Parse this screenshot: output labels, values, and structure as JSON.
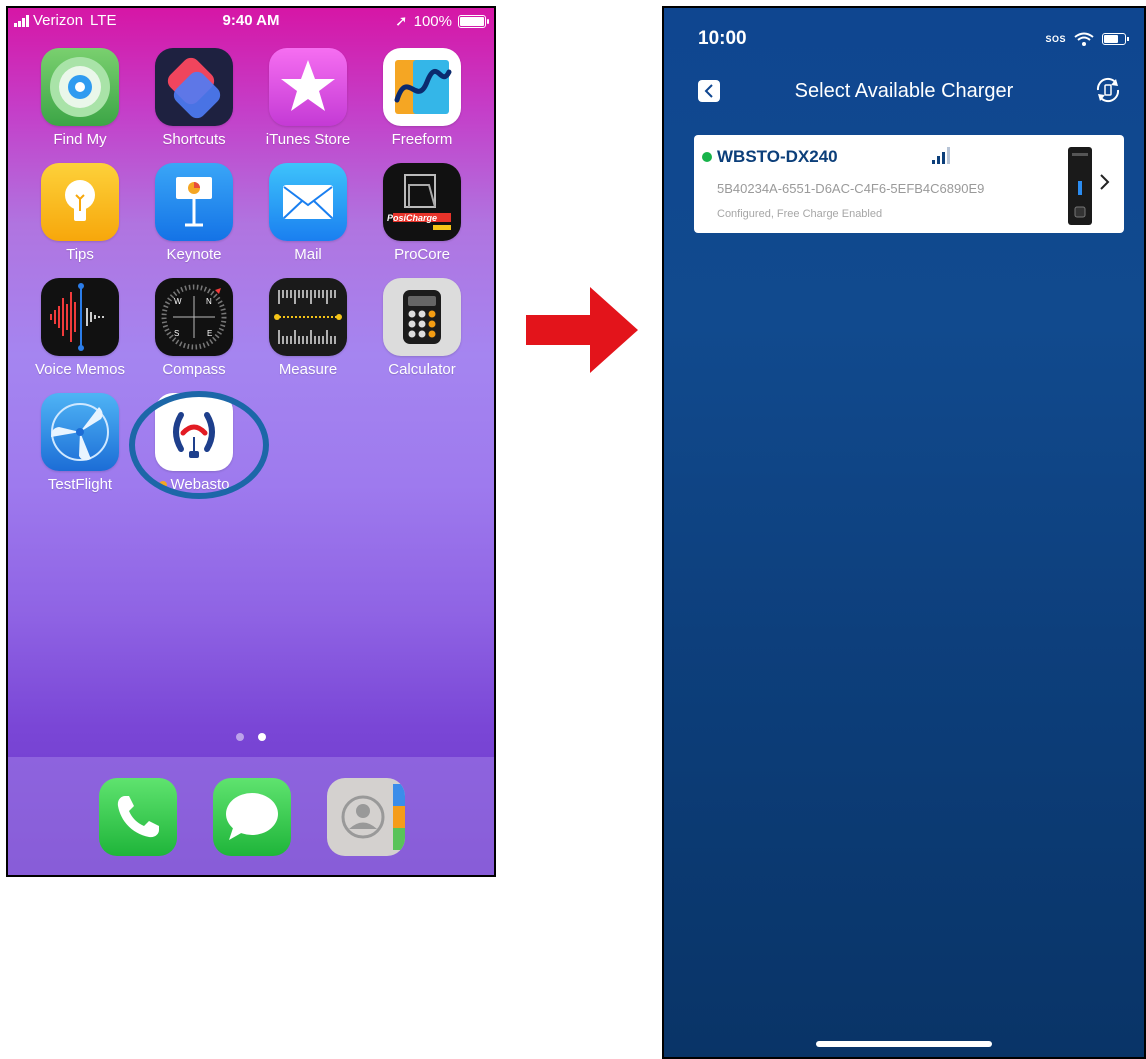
{
  "left_phone": {
    "status_bar": {
      "carrier": "Verizon",
      "network": "LTE",
      "time": "9:40 AM",
      "battery": "100%"
    },
    "apps": [
      {
        "label": "Find My",
        "icon": "find-my-icon"
      },
      {
        "label": "Shortcuts",
        "icon": "shortcuts-icon"
      },
      {
        "label": "iTunes Store",
        "icon": "itunes-store-icon"
      },
      {
        "label": "Freeform",
        "icon": "freeform-icon"
      },
      {
        "label": "Tips",
        "icon": "tips-icon"
      },
      {
        "label": "Keynote",
        "icon": "keynote-icon"
      },
      {
        "label": "Mail",
        "icon": "mail-icon"
      },
      {
        "label": "ProCore",
        "icon": "procore-icon",
        "icon_text": "PosiCharge"
      },
      {
        "label": "Voice Memos",
        "icon": "voice-memos-icon"
      },
      {
        "label": "Compass",
        "icon": "compass-icon"
      },
      {
        "label": "Measure",
        "icon": "measure-icon"
      },
      {
        "label": "Calculator",
        "icon": "calculator-icon"
      },
      {
        "label": "TestFlight",
        "icon": "testflight-icon"
      },
      {
        "label": "Webasto",
        "icon": "webasto-charger-icon"
      }
    ],
    "page_indicator": {
      "pages": 2,
      "current": 2
    },
    "dock": [
      {
        "icon": "phone-icon"
      },
      {
        "icon": "messages-icon"
      },
      {
        "icon": "contacts-icon"
      }
    ]
  },
  "right_phone": {
    "status_bar": {
      "time": "10:00",
      "sos": "SOS"
    },
    "nav_title": "Select Available Charger",
    "charger": {
      "name": "WBSTO-DX240",
      "id": "5B40234A-6551-D6AC-C4F6-5EFB4C6890E9",
      "status": "Configured, Free Charge Enabled",
      "online": true
    }
  },
  "colors": {
    "accent_blue": "#0f4690",
    "highlight_circle": "#1c67a8",
    "arrow_red": "#e3141b",
    "online_green": "#17b34a"
  }
}
